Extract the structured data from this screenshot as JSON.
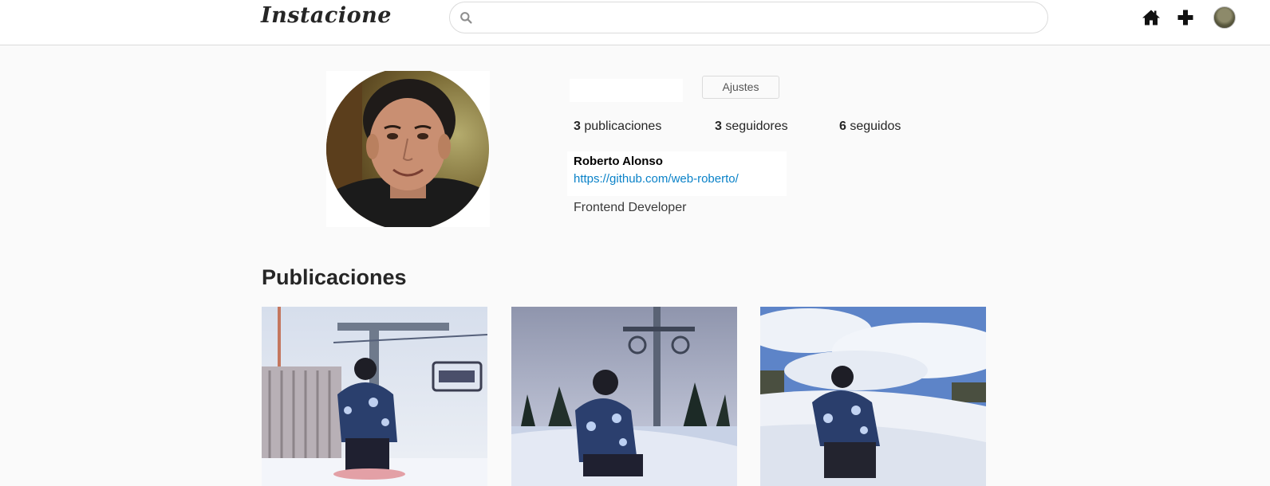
{
  "header": {
    "logo": "Instacione",
    "search": {
      "placeholder": "",
      "value": ""
    },
    "icons": [
      "search-icon",
      "home-icon",
      "plus-icon",
      "avatar"
    ]
  },
  "profile": {
    "username": "",
    "settings_label": "Ajustes",
    "stats": {
      "posts_count": "3",
      "posts_label": "publicaciones",
      "followers_count": "3",
      "followers_label": "seguidores",
      "following_count": "6",
      "following_label": "seguidos"
    },
    "full_name": "Roberto Alonso",
    "website": "https://github.com/web-roberto/",
    "description": "Frontend Developer"
  },
  "posts_section": {
    "title": "Publicaciones"
  },
  "colors": {
    "background": "#fafafa",
    "link": "#0a82c8",
    "border": "#dbdbdb"
  }
}
